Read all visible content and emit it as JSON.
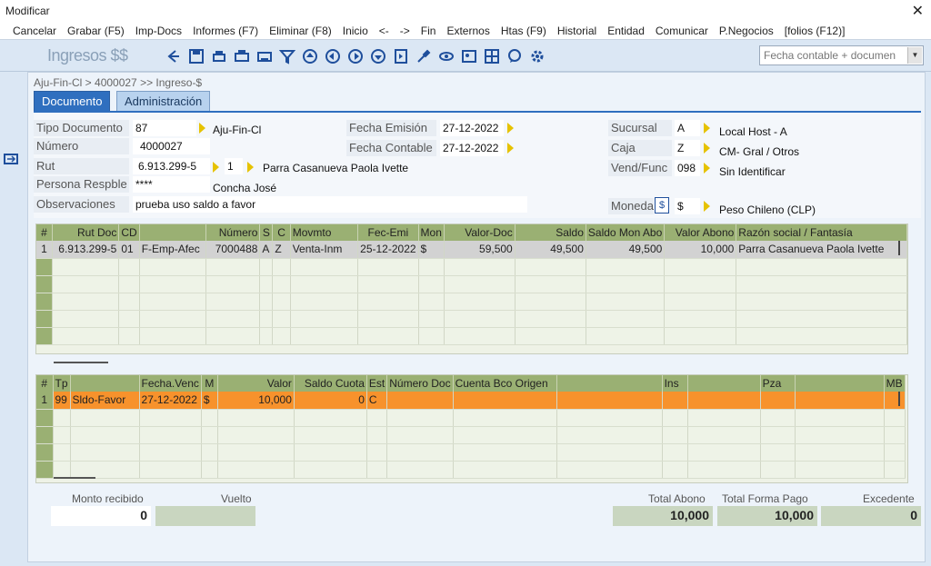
{
  "window": {
    "title": "Modificar",
    "close": "✕"
  },
  "menu": [
    "Cancelar",
    "Grabar (F5)",
    "Imp-Docs",
    "Informes (F7)",
    "Eliminar (F8)",
    "Inicio",
    "<-",
    "->",
    "Fin",
    "Externos",
    "Htas (F9)",
    "Historial",
    "Entidad",
    "Comunicar",
    "P.Negocios",
    "[folios (F12)]"
  ],
  "toolbar": {
    "module_title": "Ingresos $$",
    "filter_placeholder": "Fecha contable + documen"
  },
  "breadcrumb": "Aju-Fin-Cl > 4000027 >> Ingreso-$",
  "tabs": {
    "documento": "Documento",
    "administracion": "Administración"
  },
  "form": {
    "tipo_documento_label": "Tipo Documento",
    "tipo_documento": "87",
    "tipo_documento_desc": "Aju-Fin-Cl",
    "numero_label": "Número",
    "numero": "4000027",
    "rut_label": "Rut",
    "rut": "6.913.299-5",
    "rut_seq": "1",
    "rut_name": "Parra Casanueva Paola Ivette",
    "persona_label": "Persona Respble",
    "persona": "****",
    "persona_name": "Concha José",
    "observaciones_label": "Observaciones",
    "observaciones": "prueba uso saldo a favor",
    "fecha_emision_label": "Fecha Emisión",
    "fecha_emision": "27-12-2022",
    "fecha_contable_label": "Fecha Contable",
    "fecha_contable": "27-12-2022",
    "sucursal_label": "Sucursal",
    "sucursal": "A",
    "sucursal_desc": "Local Host - A",
    "caja_label": "Caja",
    "caja": "Z",
    "caja_desc": "CM- Gral / Otros",
    "vend_label": "Vend/Func",
    "vend": "098",
    "vend_desc": "Sin Identificar",
    "moneda_label": "Moneda",
    "moneda": "$",
    "moneda_desc": "Peso Chileno (CLP)"
  },
  "grid1": {
    "headers": [
      "#",
      "Rut Doc",
      "CD",
      "",
      "Número",
      "S",
      "C",
      "Movmto",
      "Fec-Emi",
      "Mon",
      "Valor-Doc",
      "Saldo",
      "Saldo Mon Abo",
      "Valor Abono",
      "Razón social / Fantasía"
    ],
    "rows": [
      [
        "1",
        "6.913.299-5",
        "01",
        "F-Emp-Afec",
        "7000488",
        "A",
        "Z",
        "Venta-Inm",
        "25-12-2022",
        "$",
        "59,500",
        "49,500",
        "49,500",
        "10,000",
        "Parra Casanueva Paola Ivette"
      ]
    ]
  },
  "grid2": {
    "headers": [
      "#",
      "Tp",
      "",
      "Fecha.Venc",
      "M",
      "Valor",
      "Saldo Cuota",
      "Est",
      "Número Doc",
      "Cuenta Bco Origen",
      "",
      "Ins",
      "",
      "Pza",
      "",
      "MB"
    ],
    "rows": [
      [
        "1",
        "99",
        "Sldo-Favor",
        "27-12-2022",
        "$",
        "10,000",
        "0",
        "C",
        "",
        "",
        "",
        "",
        "",
        "",
        "",
        ""
      ]
    ]
  },
  "footer": {
    "monto_recibido_label": "Monto recibido",
    "monto_recibido": "0",
    "vuelto_label": "Vuelto",
    "vuelto": "",
    "total_abono_label": "Total Abono",
    "total_abono": "10,000",
    "total_forma_pago_label": "Total Forma Pago",
    "total_forma_pago": "10,000",
    "excedente_label": "Excedente",
    "excedente": "0"
  },
  "colors": {
    "header_green": "#9ab073",
    "orange_row": "#f7922c",
    "tab_blue": "#2f6fbf"
  }
}
